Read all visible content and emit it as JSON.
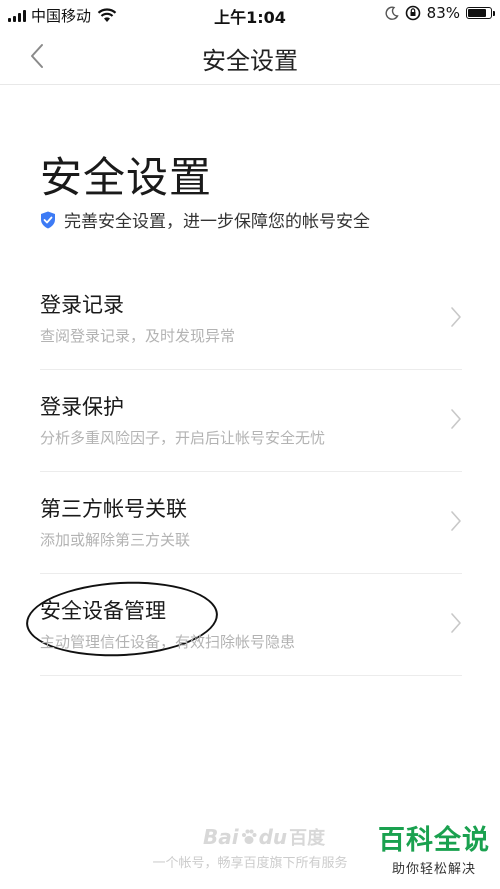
{
  "status_bar": {
    "carrier": "中国移动",
    "time": "上午1:04",
    "battery_percent": "83%",
    "battery_level": 0.83,
    "icons": [
      "signal-icon",
      "wifi-icon",
      "moon-icon",
      "rotation-lock-icon",
      "battery-icon"
    ]
  },
  "nav": {
    "back_icon": "chevron-left-icon",
    "title": "安全设置"
  },
  "header": {
    "title": "安全设置",
    "subtitle_icon": "shield-check-icon",
    "subtitle": "完善安全设置，进一步保障您的帐号安全"
  },
  "menu": {
    "items": [
      {
        "title": "登录记录",
        "desc": "查阅登录记录，及时发现异常"
      },
      {
        "title": "登录保护",
        "desc": "分析多重风险因子，开启后让帐号安全无忧"
      },
      {
        "title": "第三方帐号关联",
        "desc": "添加或解除第三方关联"
      },
      {
        "title": "安全设备管理",
        "desc": "主动管理信任设备，有效扫除帐号隐患"
      }
    ]
  },
  "footer": {
    "logo_latin": "Bai",
    "logo_latin2": "du",
    "logo_cn": "百度",
    "slogan": "一个帐号，畅享百度旗下所有服务"
  },
  "watermark": {
    "title": "百科全说",
    "subtitle": "助你轻松解决"
  },
  "colors": {
    "accent_shield": "#3d7bf5",
    "watermark_green": "#1aa14f",
    "desc_gray": "#b3b3b3"
  }
}
